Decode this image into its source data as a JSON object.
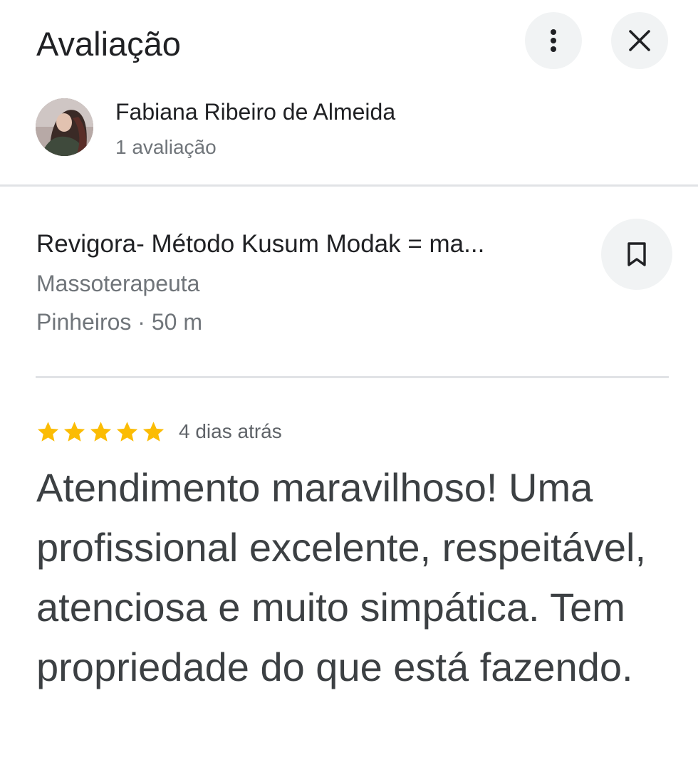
{
  "header": {
    "title": "Avaliação",
    "more_icon": "more-vert-icon",
    "close_icon": "close-icon"
  },
  "reviewer": {
    "name": "Fabiana Ribeiro de Almeida",
    "review_count": "1 avaliação"
  },
  "place": {
    "name": "Revigora- Método Kusum Modak = ma...",
    "category": "Massoterapeuta",
    "location": "Pinheiros · 50 m",
    "bookmark_icon": "bookmark-icon"
  },
  "review": {
    "rating": 5,
    "max_rating": 5,
    "star_color": "#fbbc04",
    "date": "4 dias atrás",
    "text": "Atendimento maravilhoso! Uma profissional excelente, respeitável, atenciosa e muito simpática. Tem propriedade do que está fazendo."
  }
}
